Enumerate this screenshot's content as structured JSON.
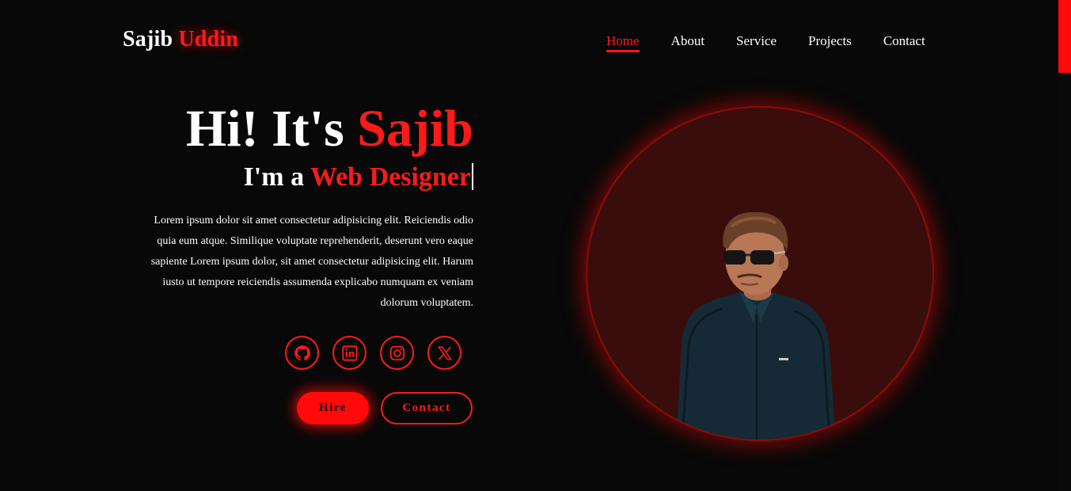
{
  "header": {
    "logo_first": "Sajib",
    "logo_second": "Uddin",
    "nav": [
      {
        "label": "Home",
        "active": true
      },
      {
        "label": "About",
        "active": false
      },
      {
        "label": "Service",
        "active": false
      },
      {
        "label": "Projects",
        "active": false
      },
      {
        "label": "Contact",
        "active": false
      }
    ]
  },
  "hero": {
    "title_prefix": "Hi! It's",
    "title_name": "Sajib",
    "subtitle_prefix": "I'm a",
    "subtitle_role": "Web Designer",
    "description": "Lorem ipsum dolor sit amet consectetur adipisicing elit. Reiciendis odio quia eum atque. Similique voluptate reprehenderit, deserunt vero eaque sapiente Lorem ipsum dolor, sit amet consectetur adipisicing elit. Harum iusto ut tempore reiciendis assumenda explicabo numquam ex veniam dolorum voluptatem.",
    "socials": [
      "github-icon",
      "linkedin-icon",
      "instagram-icon",
      "x-icon"
    ],
    "hire_label": "Hire",
    "contact_label": "Contact"
  },
  "colors": {
    "accent": "#ff1a1a",
    "background": "#080808",
    "portrait_bg": "#3a0d0d"
  }
}
